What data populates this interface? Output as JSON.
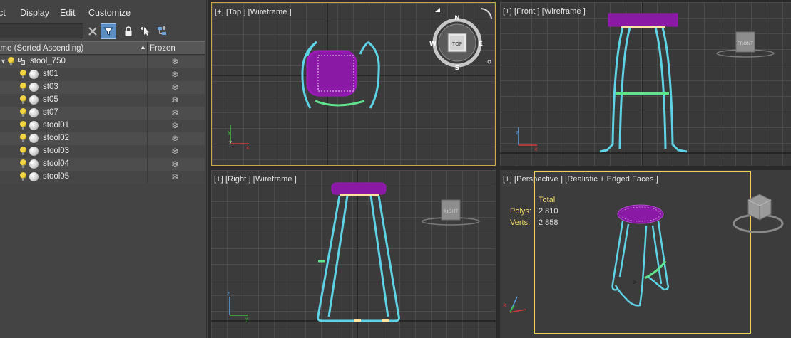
{
  "menu": [
    {
      "label": "ct"
    },
    {
      "label": "Display"
    },
    {
      "label": "Edit"
    },
    {
      "label": "Customize"
    }
  ],
  "search": {
    "value": "",
    "placeholder": ""
  },
  "columns": {
    "name": "ame (Sorted Ascending)",
    "sort_arrow": "▲",
    "frozen": "Frozen"
  },
  "tree": {
    "group": {
      "name": "stool_750",
      "expanded": true
    },
    "items": [
      {
        "name": "st01"
      },
      {
        "name": "st03"
      },
      {
        "name": "st05"
      },
      {
        "name": "st07"
      },
      {
        "name": "stool01"
      },
      {
        "name": "stool02"
      },
      {
        "name": "stool03"
      },
      {
        "name": "stool04"
      },
      {
        "name": "stool05"
      }
    ],
    "frozen_glyph": "❄"
  },
  "viewports": {
    "top": {
      "label": "[+] [Top ] [Wireframe ]",
      "viewcube": {
        "face": "TOP",
        "north": "N",
        "south": "S",
        "east": "E",
        "west": "W"
      }
    },
    "front": {
      "label": "[+] [Front ] [Wireframe ]",
      "viewcube": {
        "face": "FRONT"
      }
    },
    "right": {
      "label": "[+] [Right ] [Wireframe ]",
      "viewcube": {
        "face": "RIGHT"
      }
    },
    "perspective": {
      "label": "[+] [Perspective ] [Realistic + Edged Faces ]",
      "stats": {
        "title": "Total",
        "polys_label": "Polys:",
        "polys_value": "2 810",
        "verts_label": "Verts:",
        "verts_value": "2 858"
      }
    }
  },
  "colors": {
    "wire_cyan": "#5fd3e6",
    "seat_purple": "#9b19b8",
    "rung_green": "#5fe38c",
    "active_border": "#c9a84c",
    "safe_frame": "#f0d25a"
  }
}
